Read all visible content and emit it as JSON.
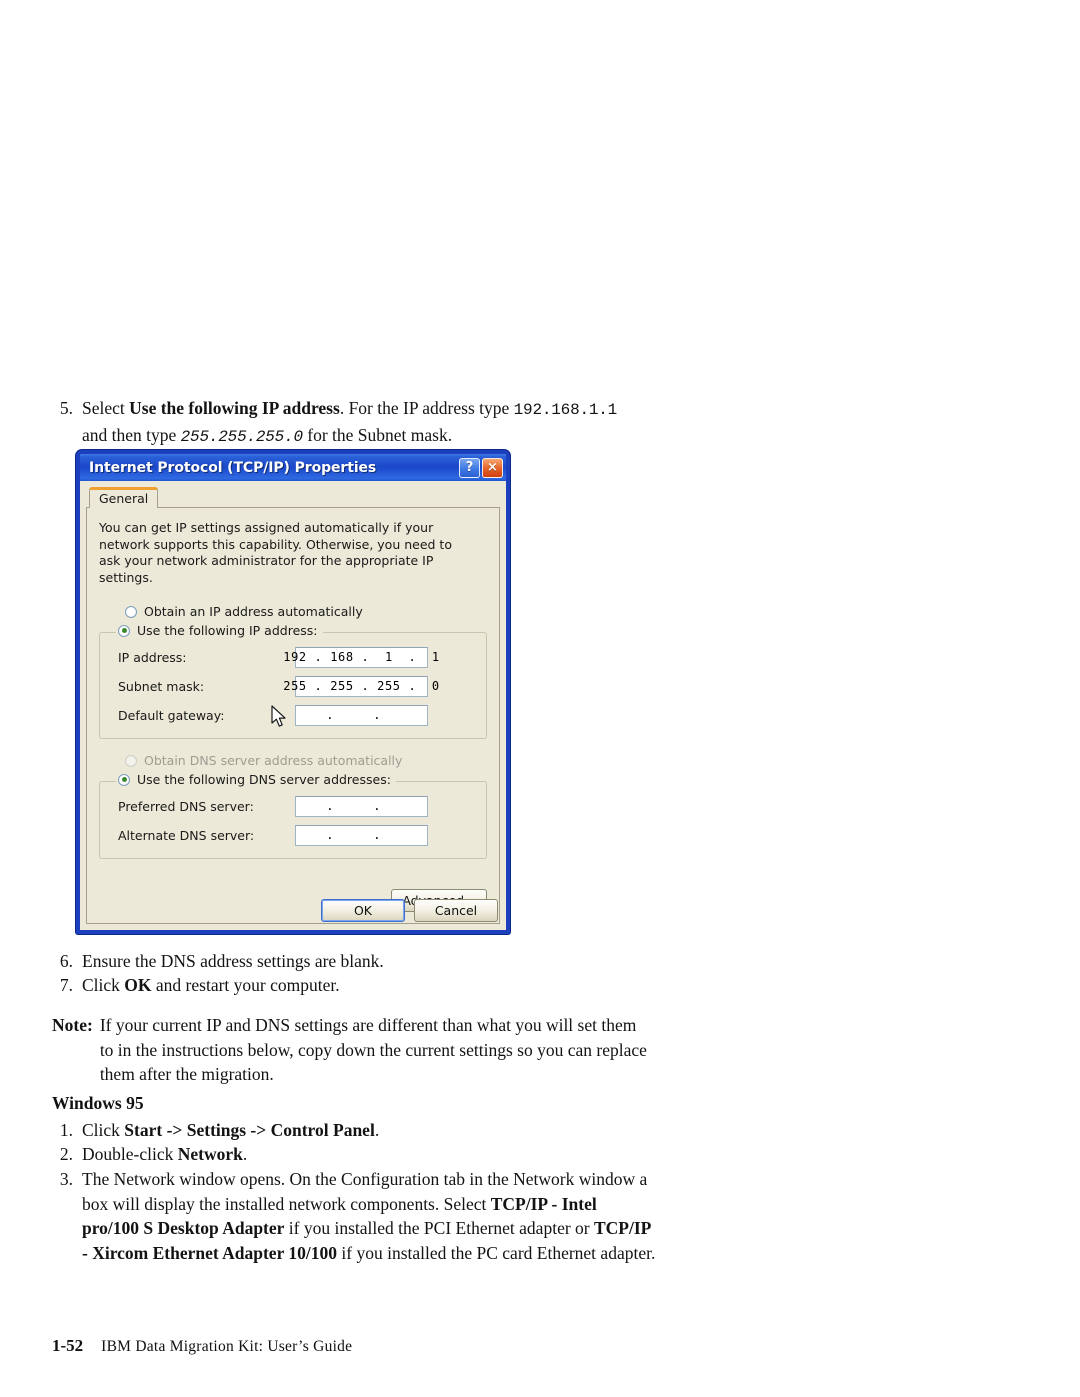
{
  "page": {
    "footer_page_number": "1-52",
    "footer_title": "IBM Data Migration Kit: User’s Guide"
  },
  "steps_top": [
    {
      "num": "5.",
      "line1_a": "Select ",
      "line1_bold": "Use the following IP address",
      "line1_b": ". For the IP address type ",
      "line1_mono": "192.168.1.1",
      "line2_a": "and then type ",
      "line2_mono_italic": "255.255.255.0",
      "line2_b": " for the Subnet mask."
    }
  ],
  "steps_after_figure": [
    {
      "num": "6.",
      "text": "Ensure the DNS address settings are blank."
    },
    {
      "num": "7.",
      "pre": "Click ",
      "bold": "OK",
      "post": " and restart your computer."
    }
  ],
  "note": {
    "label": "Note:",
    "text": "If your current IP and DNS settings are different than what you will set them to in the instructions below, copy down the current settings so you can replace them after the migration."
  },
  "windows95": {
    "heading": "Windows 95",
    "steps": [
      {
        "num": "1.",
        "pre": "Click ",
        "bold": "Start -> Settings -> Control Panel",
        "post": "."
      },
      {
        "num": "2.",
        "pre": "Double-click ",
        "bold": "Network",
        "post": "."
      },
      {
        "num": "3.",
        "pre": "The Network window opens. On the Configuration tab in the Network window a box will display the installed network components. Select ",
        "bold1": "TCP/IP - Intel pro/100 S Desktop Adapter",
        "mid": " if you installed the PCI Ethernet adapter or ",
        "bold2": "TCP/IP - Xircom Ethernet Adapter 10/100",
        "post": " if you installed the PC card Ethernet adapter."
      }
    ]
  },
  "dialog": {
    "title": "Internet Protocol (TCP/IP) Properties",
    "help_button": "?",
    "close_button": "×",
    "tab_general": "General",
    "description": "You can get IP settings assigned automatically if your network supports this capability. Otherwise, you need to ask your network administrator for the appropriate IP settings.",
    "radio_obtain_ip": "Obtain an IP address automatically",
    "radio_use_ip": "Use the following IP address:",
    "label_ip_address": "IP address:",
    "value_ip_address": "192 . 168 .  1  .  1",
    "label_subnet_mask": "Subnet mask:",
    "value_subnet_mask": "255 . 255 . 255 .  0",
    "label_default_gateway": "Default gateway:",
    "value_default_gateway": "  .     .    ",
    "radio_obtain_dns": "Obtain DNS server address automatically",
    "radio_use_dns": "Use the following DNS server addresses:",
    "label_preferred_dns": "Preferred DNS server:",
    "value_preferred_dns": "  .     .    ",
    "label_alternate_dns": "Alternate DNS server:",
    "value_alternate_dns": "  .     .    ",
    "button_advanced": "Advanced...",
    "button_ok": "OK",
    "button_cancel": "Cancel",
    "colors": {
      "titlebar_blue": "#1c47c9",
      "window_face": "#ece9d8",
      "tab_accent_orange": "#f0a030",
      "close_button_orange": "#e8662c",
      "radio_dot_green": "#3a8a2d"
    }
  }
}
